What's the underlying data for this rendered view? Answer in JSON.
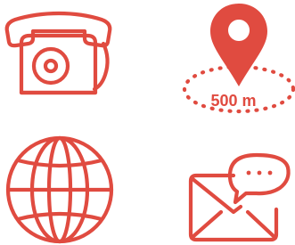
{
  "colors": {
    "accent": "#e04b40",
    "background": "#ffffff"
  },
  "icons": [
    {
      "name": "telephone-icon"
    },
    {
      "name": "location-pin-icon",
      "label": "500 m"
    },
    {
      "name": "globe-icon"
    },
    {
      "name": "envelope-message-icon"
    }
  ]
}
